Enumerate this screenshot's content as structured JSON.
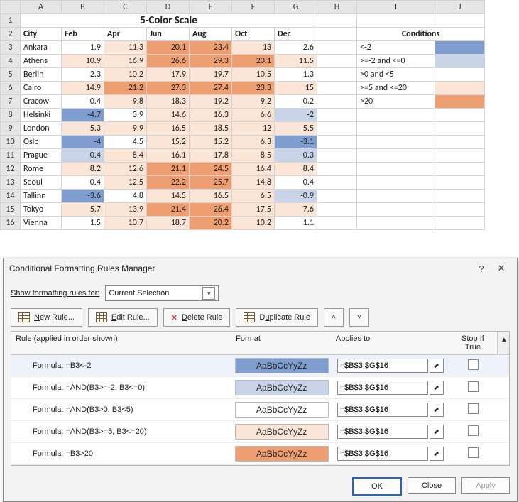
{
  "sheet": {
    "title": "5-Color Scale",
    "columns": [
      "A",
      "B",
      "C",
      "D",
      "E",
      "F",
      "G",
      "H",
      "I",
      "J"
    ],
    "row_numbers": [
      1,
      2,
      3,
      4,
      5,
      6,
      7,
      8,
      9,
      10,
      11,
      12,
      13,
      14,
      15,
      16
    ],
    "header_row": {
      "city": "City",
      "feb": "Feb",
      "apr": "Apr",
      "jun": "Jun",
      "aug": "Aug",
      "oct": "Oct",
      "dec": "Dec"
    },
    "conditions_header": "Conditions",
    "data": [
      {
        "city": "Ankara",
        "v": [
          1.9,
          11.3,
          20.1,
          23.4,
          13,
          2.6
        ]
      },
      {
        "city": "Athens",
        "v": [
          10.9,
          16.9,
          26.6,
          29.3,
          20.1,
          11.5
        ]
      },
      {
        "city": "Berlin",
        "v": [
          2.3,
          10.2,
          17.9,
          19.7,
          10.5,
          1.3
        ]
      },
      {
        "city": "Cairo",
        "v": [
          14.9,
          21.2,
          27.3,
          27.4,
          23.3,
          15
        ]
      },
      {
        "city": "Cracow",
        "v": [
          0.4,
          9.8,
          18.3,
          19.2,
          9.2,
          0.2
        ]
      },
      {
        "city": "Helsinki",
        "v": [
          -4.7,
          3.9,
          14.6,
          16.3,
          6.6,
          -2
        ]
      },
      {
        "city": "London",
        "v": [
          5.3,
          9.9,
          16.5,
          18.5,
          12,
          5.5
        ]
      },
      {
        "city": "Oslo",
        "v": [
          -4,
          4.5,
          15.2,
          15.2,
          6.3,
          -3.1
        ]
      },
      {
        "city": "Prague",
        "v": [
          -0.4,
          8.4,
          16.1,
          17.8,
          8.5,
          -0.3
        ]
      },
      {
        "city": "Rome",
        "v": [
          8.2,
          12.6,
          21.1,
          24.5,
          16.4,
          8.4
        ]
      },
      {
        "city": "Seoul",
        "v": [
          0.4,
          12.5,
          22.2,
          25.7,
          14.8,
          0.4
        ]
      },
      {
        "city": "Tallinn",
        "v": [
          -3.6,
          4.8,
          14.5,
          16.5,
          6.5,
          -0.9
        ]
      },
      {
        "city": "Tokyo",
        "v": [
          5.7,
          13.9,
          21.4,
          26.4,
          17.5,
          7.6
        ]
      },
      {
        "city": "Vienna",
        "v": [
          1.5,
          10.7,
          18.7,
          20.2,
          10.2,
          1.1
        ]
      }
    ],
    "conditions": [
      {
        "label": "<-2",
        "cls": "c1"
      },
      {
        "label": ">=-2 and <=0",
        "cls": "c2"
      },
      {
        "label": ">0 and <5",
        "cls": "c3"
      },
      {
        "label": ">=5 and <=20",
        "cls": "c4"
      },
      {
        "label": ">20",
        "cls": "c5"
      }
    ]
  },
  "chart_data": {
    "type": "table",
    "title": "5-Color Scale",
    "columns": [
      "City",
      "Feb",
      "Apr",
      "Jun",
      "Aug",
      "Oct",
      "Dec"
    ],
    "rows": [
      [
        "Ankara",
        1.9,
        11.3,
        20.1,
        23.4,
        13,
        2.6
      ],
      [
        "Athens",
        10.9,
        16.9,
        26.6,
        29.3,
        20.1,
        11.5
      ],
      [
        "Berlin",
        2.3,
        10.2,
        17.9,
        19.7,
        10.5,
        1.3
      ],
      [
        "Cairo",
        14.9,
        21.2,
        27.3,
        27.4,
        23.3,
        15
      ],
      [
        "Cracow",
        0.4,
        9.8,
        18.3,
        19.2,
        9.2,
        0.2
      ],
      [
        "Helsinki",
        -4.7,
        3.9,
        14.6,
        16.3,
        6.6,
        -2
      ],
      [
        "London",
        5.3,
        9.9,
        16.5,
        18.5,
        12,
        5.5
      ],
      [
        "Oslo",
        -4,
        4.5,
        15.2,
        15.2,
        6.3,
        -3.1
      ],
      [
        "Prague",
        -0.4,
        8.4,
        16.1,
        17.8,
        8.5,
        -0.3
      ],
      [
        "Rome",
        8.2,
        12.6,
        21.1,
        24.5,
        16.4,
        8.4
      ],
      [
        "Seoul",
        0.4,
        12.5,
        22.2,
        25.7,
        14.8,
        0.4
      ],
      [
        "Tallinn",
        -3.6,
        4.8,
        14.5,
        16.5,
        6.5,
        -0.9
      ],
      [
        "Tokyo",
        5.7,
        13.9,
        21.4,
        26.4,
        17.5,
        7.6
      ],
      [
        "Vienna",
        1.5,
        10.7,
        18.7,
        20.2,
        10.2,
        1.1
      ]
    ],
    "color_scale_rules": [
      {
        "rule": "< -2",
        "color": "#7f9ecf"
      },
      {
        "rule": ">= -2 and <= 0",
        "color": "#c9d4e8"
      },
      {
        "rule": "> 0 and < 5",
        "color": "#ffffff"
      },
      {
        "rule": ">= 5 and <= 20",
        "color": "#fbe5d6"
      },
      {
        "rule": "> 20",
        "color": "#ed9f72"
      }
    ]
  },
  "dialog": {
    "title": "Conditional Formatting Rules Manager",
    "help": "?",
    "close": "✕",
    "show_label": "Show formatting rules for:",
    "selection": "Current Selection",
    "buttons": {
      "new": "New Rule...",
      "edit": "Edit Rule...",
      "delete": "Delete Rule",
      "duplicate": "Duplicate Rule"
    },
    "headers": {
      "rule": "Rule (applied in order shown)",
      "format": "Format",
      "applies": "Applies to",
      "stop": "Stop If True"
    },
    "sample_text": "AaBbCcYyZz",
    "applies_value": "=$B$3:$G$16",
    "rules": [
      {
        "formula": "Formula: =B3<-2",
        "cls": "c1"
      },
      {
        "formula": "Formula: =AND(B3>=-2, B3<=0)",
        "cls": "c2"
      },
      {
        "formula": "Formula: =AND(B3>0, B3<5)",
        "cls": "c3"
      },
      {
        "formula": "Formula: =AND(B3>=5, B3<=20)",
        "cls": "c4"
      },
      {
        "formula": "Formula: =B3>20",
        "cls": "c5"
      }
    ],
    "footer": {
      "ok": "OK",
      "close": "Close",
      "apply": "Apply"
    }
  }
}
